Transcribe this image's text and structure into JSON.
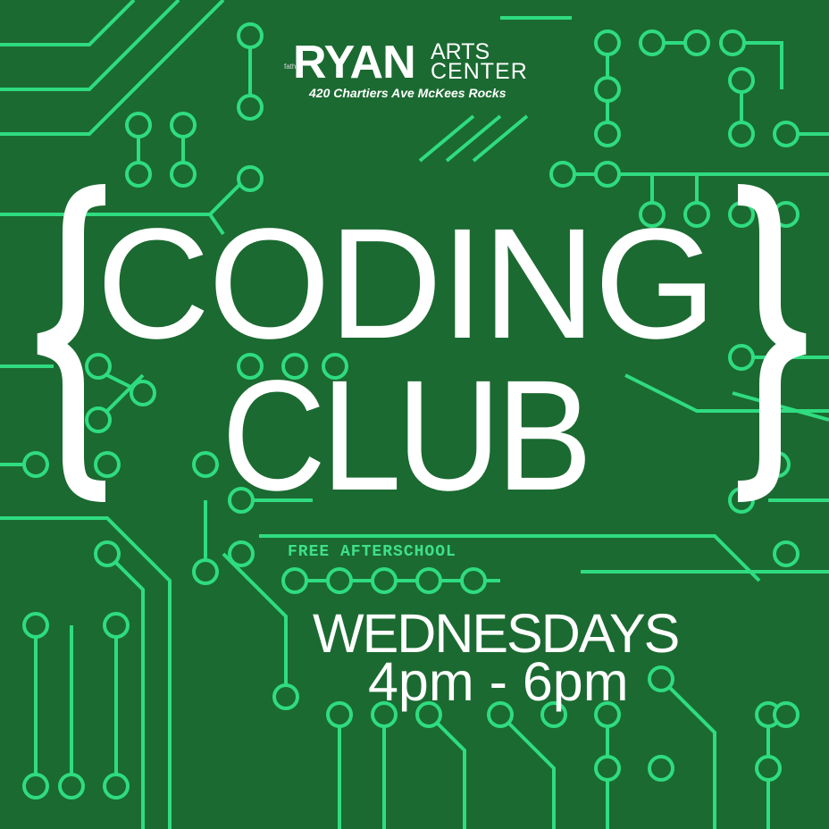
{
  "logo": {
    "small": "father",
    "name": "RYAN",
    "line1": "ARTS",
    "line2": "CENTER",
    "address": "420 Chartiers Ave McKees Rocks"
  },
  "title": {
    "line1": "CODING",
    "line2": "CLUB",
    "open_brace": "{",
    "close_brace": "}"
  },
  "subtitle": "FREE AFTERSCHOOL",
  "schedule": {
    "day": "WEDNESDAYS",
    "time": "4pm - 6pm"
  },
  "colors": {
    "background": "#1b6a31",
    "trace": "#2fdc80",
    "text": "#ffffff"
  }
}
